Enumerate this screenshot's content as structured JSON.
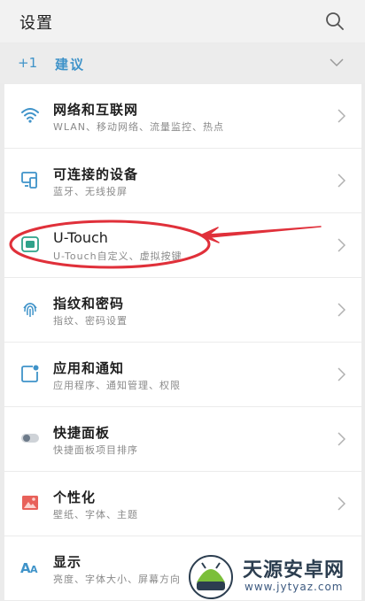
{
  "header": {
    "title": "设置"
  },
  "suggestion": {
    "badge": "+1",
    "label": "建议"
  },
  "items": [
    {
      "title": "网络和互联网",
      "subtitle": "WLAN、移动网络、流量监控、热点",
      "icon": "wifi-icon"
    },
    {
      "title": "可连接的设备",
      "subtitle": "蓝牙、无线投屏",
      "icon": "devices-icon"
    },
    {
      "title": "U-Touch",
      "subtitle": "U-Touch自定义、虚拟按键",
      "icon": "utouch-icon"
    },
    {
      "title": "指纹和密码",
      "subtitle": "指纹、密码设置",
      "icon": "fingerprint-icon"
    },
    {
      "title": "应用和通知",
      "subtitle": "应用程序、通知管理、权限",
      "icon": "apps-icon"
    },
    {
      "title": "快捷面板",
      "subtitle": "快捷面板项目排序",
      "icon": "toggle-icon"
    },
    {
      "title": "个性化",
      "subtitle": "壁纸、字体、主题",
      "icon": "personalize-icon"
    },
    {
      "title": "显示",
      "subtitle": "亮度、字体大小、屏幕方向",
      "icon": "display-icon"
    }
  ],
  "colors": {
    "accent": "#3f93c9",
    "annotation": "#e0303a"
  },
  "watermark": {
    "name": "天源安卓网",
    "url": "www.jytyaz.com"
  }
}
